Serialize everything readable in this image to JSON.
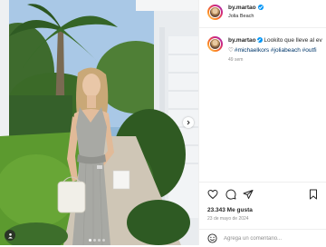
{
  "post": {
    "username": "by.martao",
    "location": "Jolia Beach",
    "caption_text": "Lookito que lleve al ev",
    "caption_hashtags": "#michaelkors #joliabeach #outfi",
    "time_ago": "49 sem",
    "likes": "23.343 Me gusta",
    "date": "23 de mayo de 2024"
  },
  "comment": {
    "placeholder": "Agrega un comentario..."
  },
  "carousel": {
    "total": 4,
    "active_index": 0
  },
  "colors": {
    "verified": "#0095f6",
    "hashtag": "#00376b",
    "muted": "#8e8e8e",
    "border": "#efefef"
  }
}
